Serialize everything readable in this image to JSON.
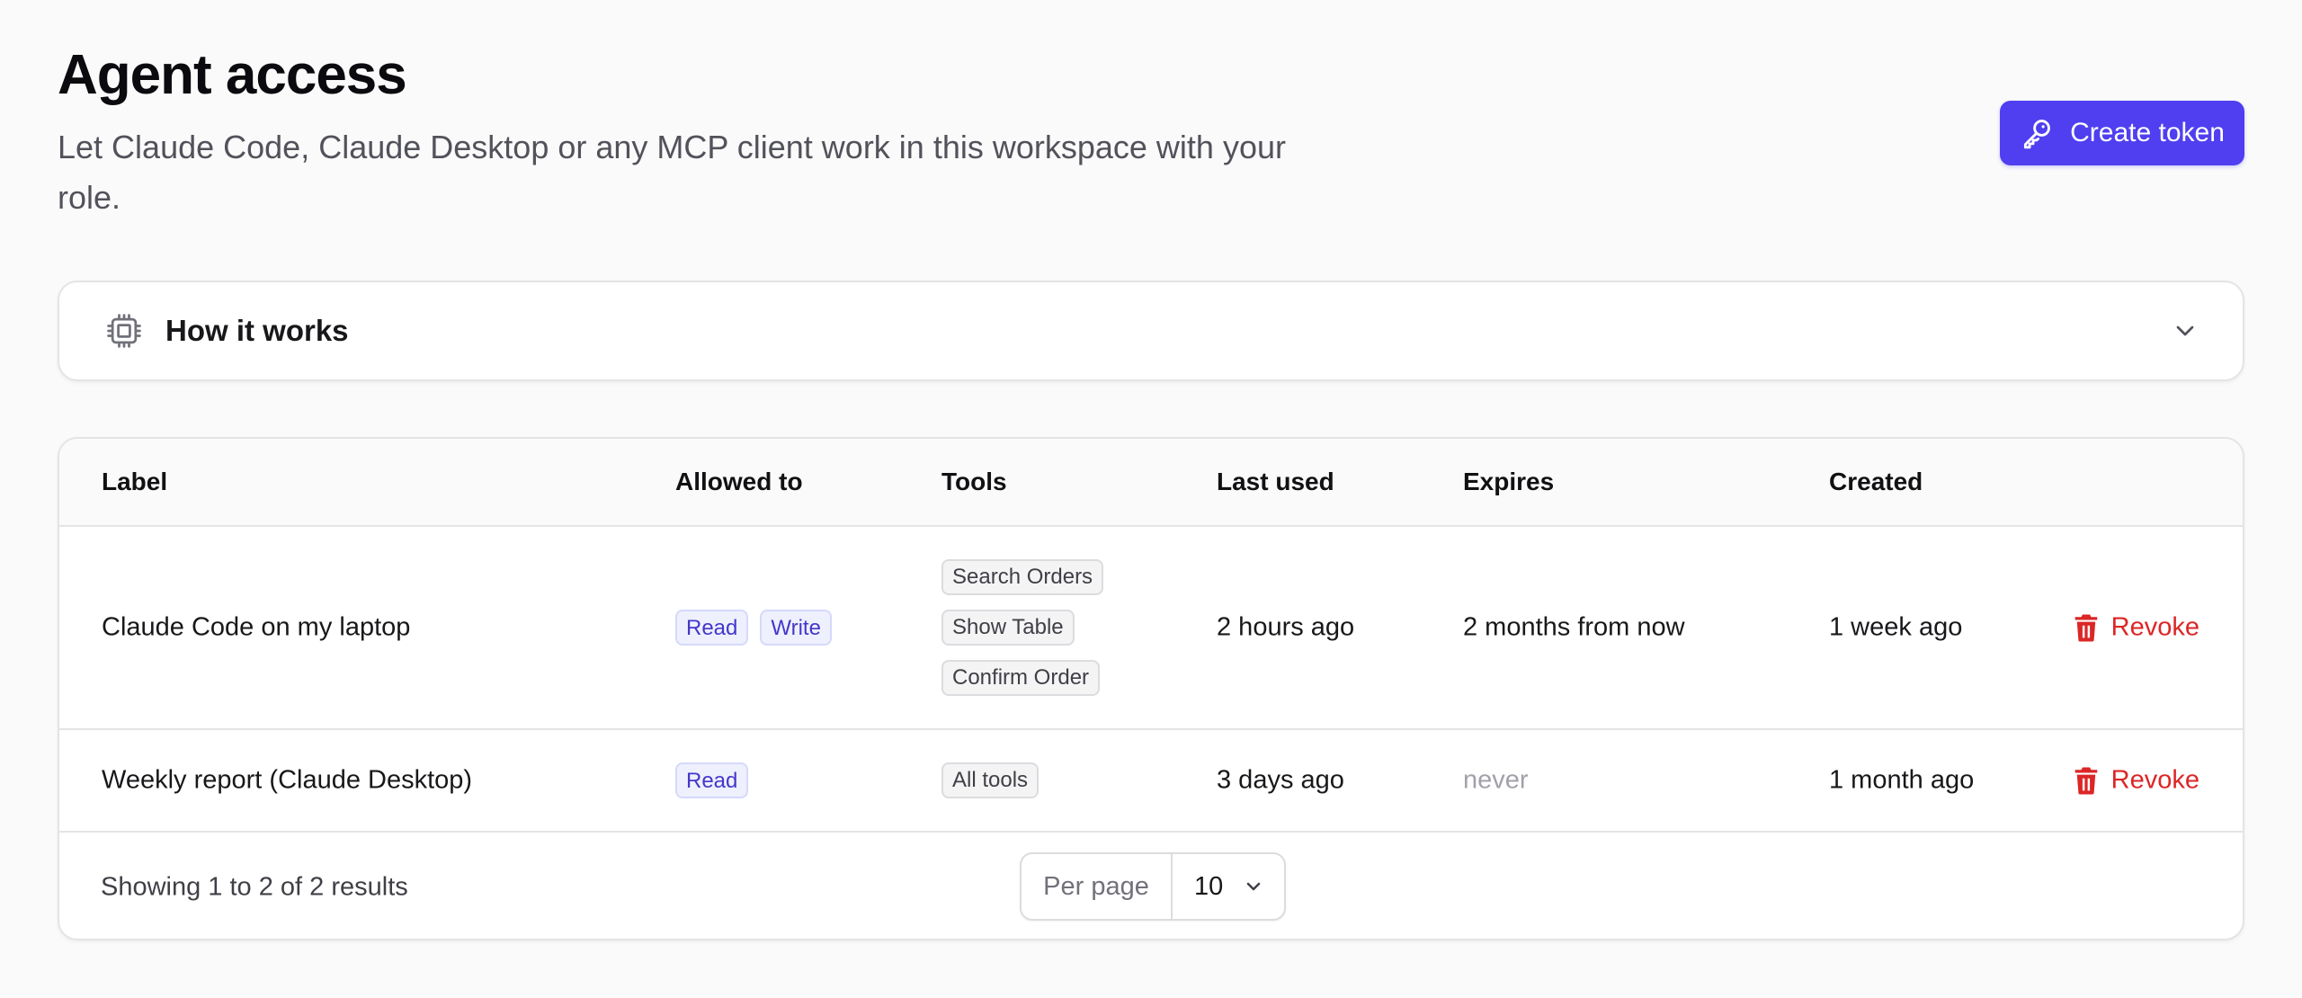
{
  "header": {
    "title": "Agent access",
    "subtitle": "Let Claude Code, Claude Desktop or any MCP client work in this workspace with your role.",
    "create_button_label": "Create token",
    "accent_color": "#4f3ff0"
  },
  "how_it_works": {
    "label": "How it works",
    "icon": "cpu-chip-icon",
    "expanded": false
  },
  "table": {
    "columns": [
      "Label",
      "Allowed to",
      "Tools",
      "Last used",
      "Expires",
      "Created"
    ],
    "rows": [
      {
        "label": "Claude Code on my laptop",
        "allowed": [
          "Read",
          "Write"
        ],
        "tools": [
          "Search Orders",
          "Show Table",
          "Confirm Order"
        ],
        "last_used": "2 hours ago",
        "expires": "2 months from now",
        "created": "1 week ago",
        "action": "Revoke"
      },
      {
        "label": "Weekly report (Claude Desktop)",
        "allowed": [
          "Read"
        ],
        "tools": [
          "All tools"
        ],
        "last_used": "3 days ago",
        "expires": "never",
        "created": "1 month ago",
        "action": "Revoke"
      }
    ],
    "danger_color": "#dc2626"
  },
  "footer": {
    "results_text": "Showing 1 to 2 of 2 results",
    "per_page_label": "Per page",
    "per_page_value": "10"
  }
}
